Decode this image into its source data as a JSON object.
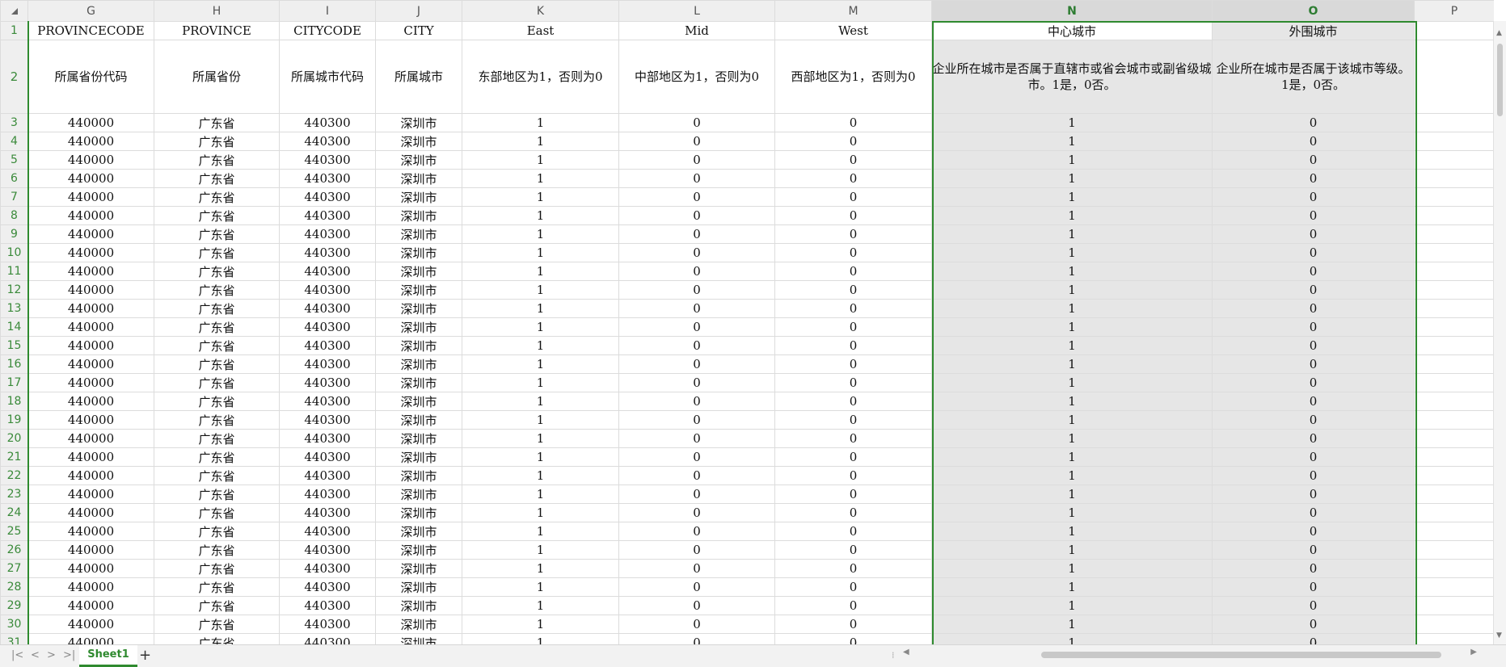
{
  "columns": [
    "G",
    "H",
    "I",
    "J",
    "K",
    "L",
    "M",
    "N",
    "O",
    "P"
  ],
  "header_row": {
    "num": "1",
    "cells": [
      "PROVINCECODE",
      "PROVINCE",
      "CITYCODE",
      "CITY",
      "East",
      "Mid",
      "West",
      "中心城市",
      "外围城市",
      ""
    ]
  },
  "desc_row": {
    "num": "2",
    "cells": [
      "所属省份代码",
      "所属省份",
      "所属城市代码",
      "所属城市",
      "东部地区为1，否则为0",
      "中部地区为1，否则为0",
      "西部地区为1，否则为0",
      "企业所在城市是否属于直辖市或省会城市或副省级城市。1是，0否。",
      "企业所在城市是否属于该城市等级。1是，0否。",
      ""
    ]
  },
  "data_row": [
    "440000",
    "广东省",
    "440300",
    "深圳市",
    "1",
    "0",
    "0",
    "1",
    "0",
    ""
  ],
  "row_numbers": [
    "3",
    "4",
    "5",
    "6",
    "7",
    "8",
    "9",
    "10",
    "11",
    "12",
    "13",
    "14",
    "15",
    "16",
    "17",
    "18",
    "19",
    "20",
    "21",
    "22",
    "23",
    "24",
    "25",
    "26",
    "27",
    "28",
    "29",
    "30",
    "31"
  ],
  "sheet": {
    "tab": "Sheet1",
    "add": "+"
  },
  "nav_icons": [
    "first-sheet-icon",
    "prev-sheet-icon",
    "next-sheet-icon",
    "last-sheet-icon"
  ],
  "colors": {
    "accent": "#2f8a2f",
    "selected_fill": "#e6e6e6",
    "header_bg": "#efefef"
  }
}
